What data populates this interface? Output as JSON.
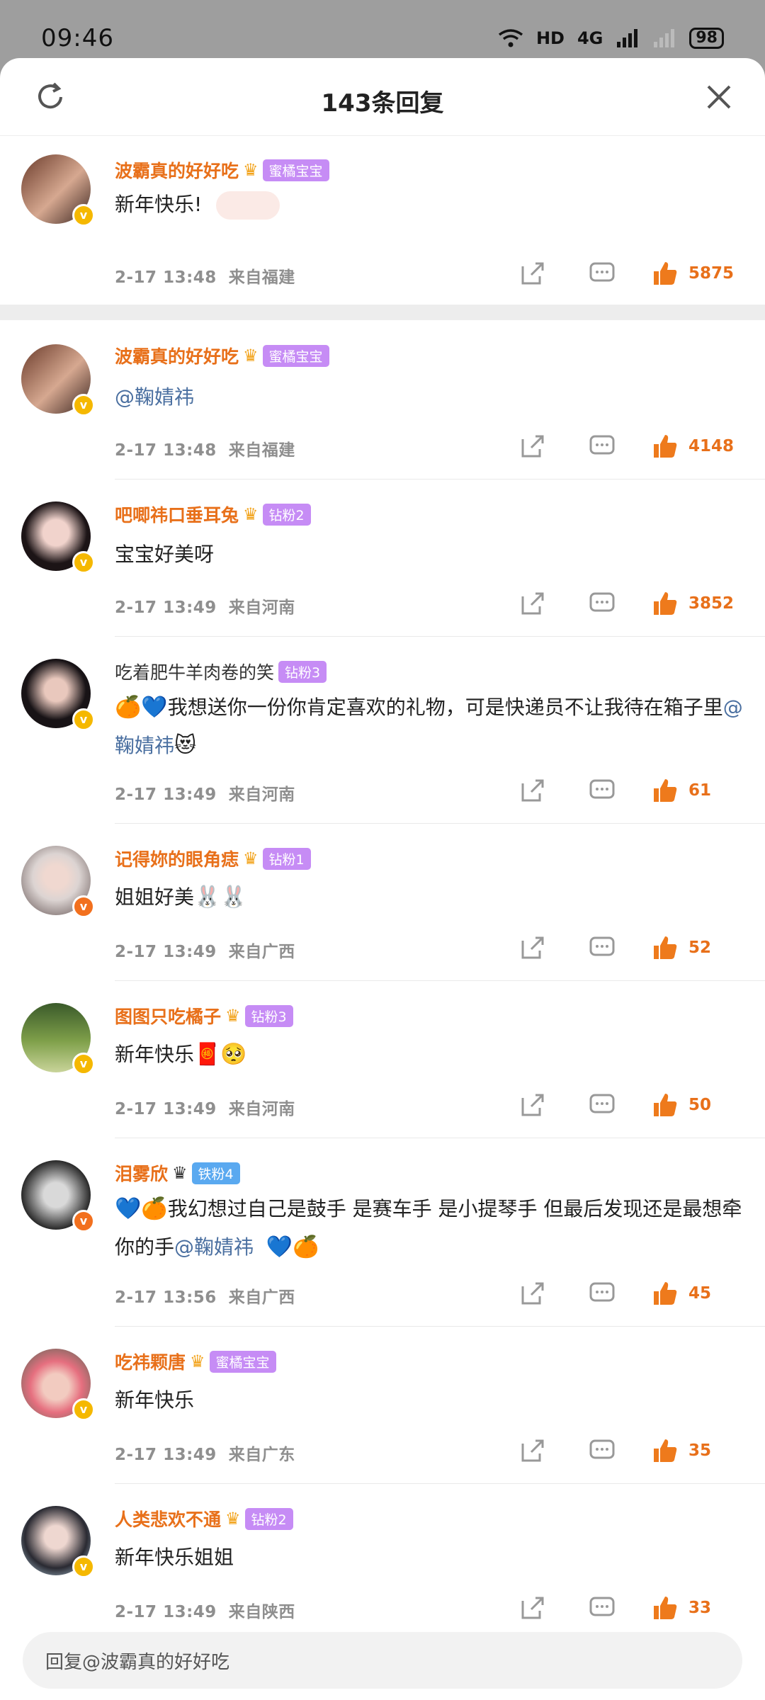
{
  "status_bar": {
    "time": "09:46",
    "network": "HD",
    "signal": "4G",
    "battery": "98"
  },
  "header": {
    "title": "143条回复"
  },
  "comments": [
    {
      "username": "波霸真的好好吃",
      "badge": "蜜橘宝宝",
      "text": "新年快乐!",
      "time": "2-17  13:48",
      "location": "来自福建",
      "likes": "5875"
    },
    {
      "username": "波霸真的好好吃",
      "badge": "蜜橘宝宝",
      "mention": "@鞠婧祎",
      "time": "2-17  13:48",
      "location": "来自福建",
      "likes": "4148"
    },
    {
      "username": "吧唧祎口垂耳兔",
      "badge": "钻粉2",
      "text": "宝宝好美呀",
      "time": "2-17  13:49",
      "location": "来自河南",
      "likes": "3852"
    },
    {
      "username": "吃着肥牛羊肉卷的笑",
      "badge": "钻粉3",
      "text": "我想送你一份你肯定喜欢的礼物，可是快递员不让我待在箱子里",
      "mention": "@鞠婧祎",
      "time": "2-17  13:49",
      "location": "来自河南",
      "likes": "61"
    },
    {
      "username": "记得妳的眼角痣",
      "badge": "钻粉1",
      "text": "姐姐好美",
      "time": "2-17  13:49",
      "location": "来自广西",
      "likes": "52"
    },
    {
      "username": "图图只吃橘子",
      "badge": "钻粉3",
      "text": "新年快乐",
      "time": "2-17  13:49",
      "location": "来自河南",
      "likes": "50"
    },
    {
      "username": "泪雾欣",
      "badge": "铁粉4",
      "text": "我幻想过自己是鼓手  是赛车手  是小提琴手  但最后发现还是最想牵你的手",
      "mention": "@鞠婧祎",
      "time": "2-17  13:56",
      "location": "来自广西",
      "likes": "45"
    },
    {
      "username": "吃祎颗唐",
      "badge": "蜜橘宝宝",
      "text": "新年快乐",
      "time": "2-17  13:49",
      "location": "来自广东",
      "likes": "35"
    },
    {
      "username": "人类悲欢不通",
      "badge": "钻粉2",
      "text": "新年快乐姐姐",
      "time": "2-17  13:49",
      "location": "来自陕西",
      "likes": "33"
    }
  ],
  "reply_box": {
    "placeholder": "回复@波霸真的好好吃"
  },
  "colors": {
    "accent": "#e8701a",
    "mention": "#4a6fa0",
    "meta": "#8f8f8f"
  }
}
